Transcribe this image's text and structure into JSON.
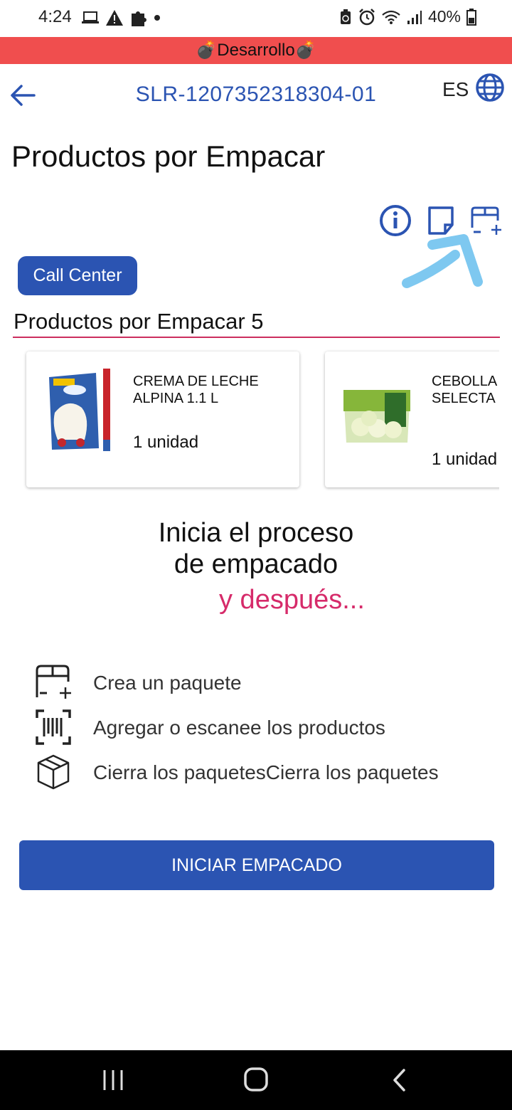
{
  "status_bar": {
    "time": "4:24",
    "battery": "40%",
    "icons": [
      "laptop-icon",
      "warning-icon",
      "puzzle-icon",
      "dot-icon",
      "recycle-icon",
      "alarm-icon",
      "wifi-icon",
      "signal-icon",
      "battery-icon"
    ]
  },
  "dev_banner": {
    "label": "💣Desarrollo💣",
    "color": "#f04e4e"
  },
  "header": {
    "order_id": "SLR-1207352318304-01",
    "language": "ES"
  },
  "page": {
    "title": "Productos por Empacar"
  },
  "call_center": {
    "label": "Call Center"
  },
  "section": {
    "heading": "Productos por Empacar 5"
  },
  "products": [
    {
      "name": "CREMA DE LECHE ALPINA 1.1 L",
      "qty": "1 unidad"
    },
    {
      "name": "CEBOLLA BLANCA SELECTA GIRALDA",
      "qty": "1 unidad"
    }
  ],
  "prompt": {
    "line1": "Inicia el proceso",
    "line2": "de empacado",
    "accent": "y después..."
  },
  "steps": [
    {
      "icon": "package-add-icon",
      "label": "Crea un paquete"
    },
    {
      "icon": "barcode-scan-icon",
      "label": "Agregar o escanee los productos"
    },
    {
      "icon": "box-icon",
      "label": "Cierra los paquetesCierra los paquetes"
    }
  ],
  "start_button": {
    "label": "INICIAR EMPACADO"
  },
  "colors": {
    "primary": "#2b54b2",
    "accent": "#d62b6a",
    "annotation": "#7ec8f0"
  }
}
